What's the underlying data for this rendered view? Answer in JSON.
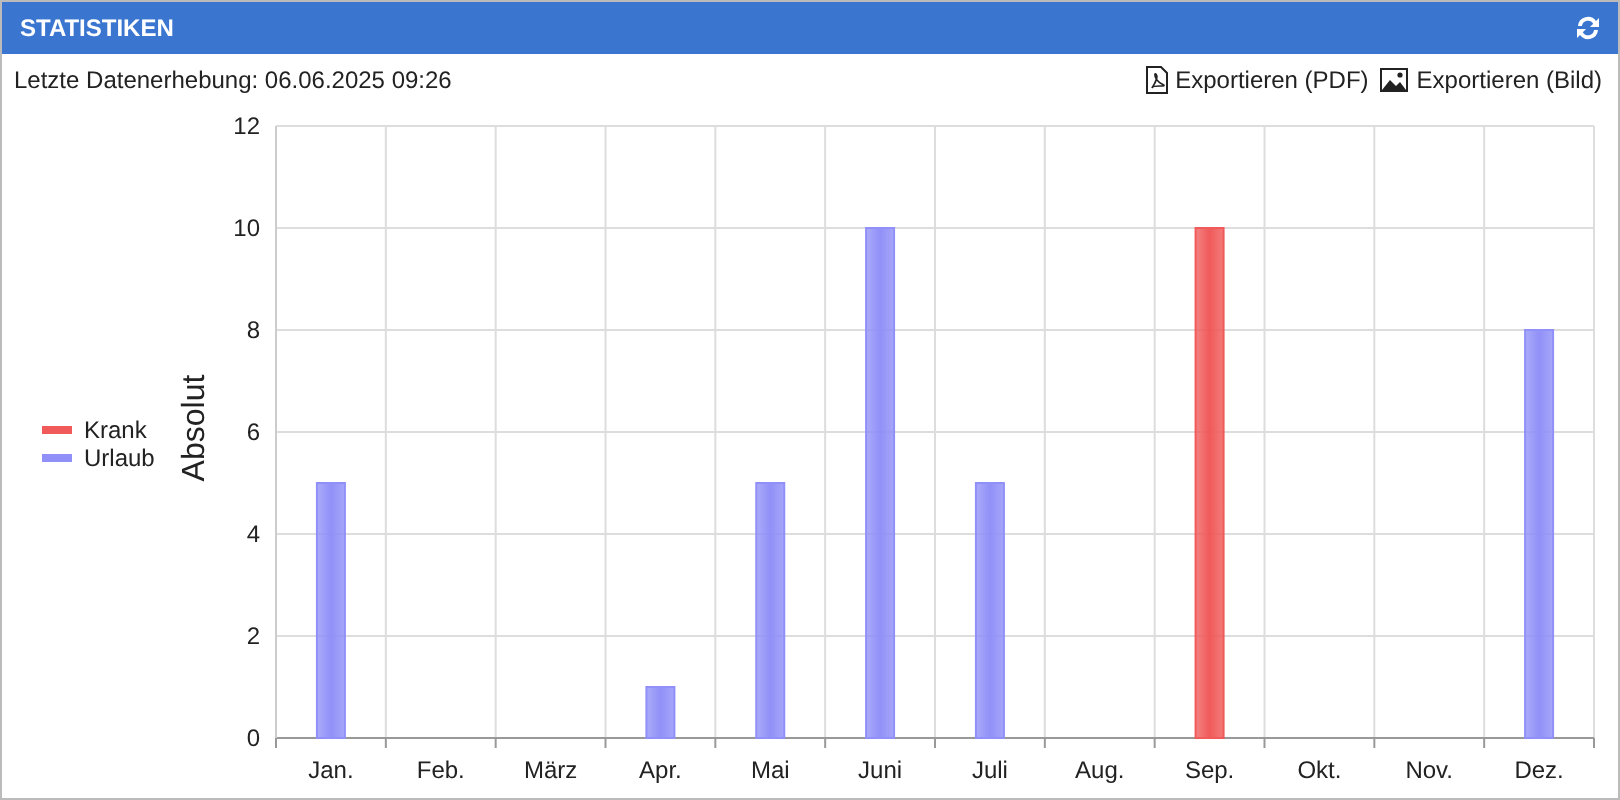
{
  "panel": {
    "title": "STATISTIKEN",
    "last_update": "Letzte Datenerhebung: 06.06.2025 09:26",
    "actions": [
      {
        "label": "Exportieren (PDF)",
        "kind": "pdf"
      },
      {
        "label": "Exportieren (Bild)",
        "kind": "image"
      }
    ]
  },
  "chart_data": {
    "type": "bar",
    "grid": true,
    "legend": true,
    "ylabel": "Absolut",
    "stacked": true,
    "categories": [
      "Jan.",
      "Feb.",
      "März",
      "Apr.",
      "Mai",
      "Juni",
      "Juli",
      "Aug.",
      "Sep.",
      "Okt.",
      "Nov.",
      "Dez."
    ],
    "ylim": [
      0,
      12
    ],
    "yticks": [
      0,
      2,
      4,
      6,
      8,
      10,
      12
    ],
    "series": [
      {
        "name": "Krank",
        "color": "#f05a5a",
        "values": [
          0,
          0,
          0,
          0,
          0,
          0,
          0,
          0,
          10,
          0,
          0,
          0
        ]
      },
      {
        "name": "Urlaub",
        "color": "#9090f8",
        "values": [
          5,
          0,
          0,
          1,
          5,
          10,
          5,
          0,
          0,
          0,
          0,
          8
        ]
      }
    ]
  }
}
